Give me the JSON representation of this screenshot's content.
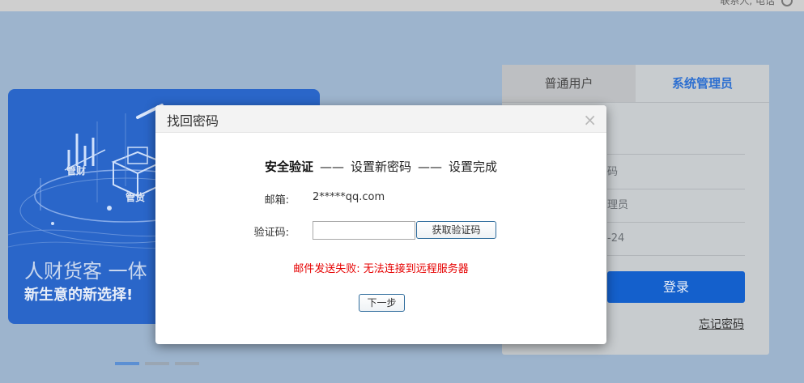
{
  "top_bar": {
    "links": "联系人, 电话",
    "power_icon": "power-icon"
  },
  "banner": {
    "tag_finance": "管财",
    "tag_goods": "管货",
    "title": "人财货客 一体",
    "subtitle": "新生意的新选择!"
  },
  "carousel": {
    "active_index": 0,
    "count": 3
  },
  "login": {
    "tabs": [
      {
        "label": "普通用户",
        "active": false
      },
      {
        "label": "系统管理员",
        "active": true
      }
    ],
    "fields": [
      {
        "text": ""
      },
      {
        "text": "码"
      },
      {
        "text": "理员"
      },
      {
        "text": "-24"
      }
    ],
    "submit_label": "登录",
    "forgot_label": "忘记密码"
  },
  "modal": {
    "title": "找回密码",
    "close_icon": "close-icon",
    "steps": [
      {
        "label": "安全验证",
        "active": true
      },
      {
        "label": "设置新密码",
        "active": false
      },
      {
        "label": "设置完成",
        "active": false
      }
    ],
    "step_separator": "——",
    "email_label": "邮箱:",
    "email_value": "2*****qq.com",
    "code_label": "验证码:",
    "code_value": "",
    "get_code_button": "获取验证码",
    "error_message": "邮件发送失败: 无法连接到远程服务器",
    "next_button": "下一步"
  },
  "colors": {
    "brand_blue": "#1460cc",
    "error_red": "#e60000",
    "active_tab": "#2d6fd0"
  }
}
